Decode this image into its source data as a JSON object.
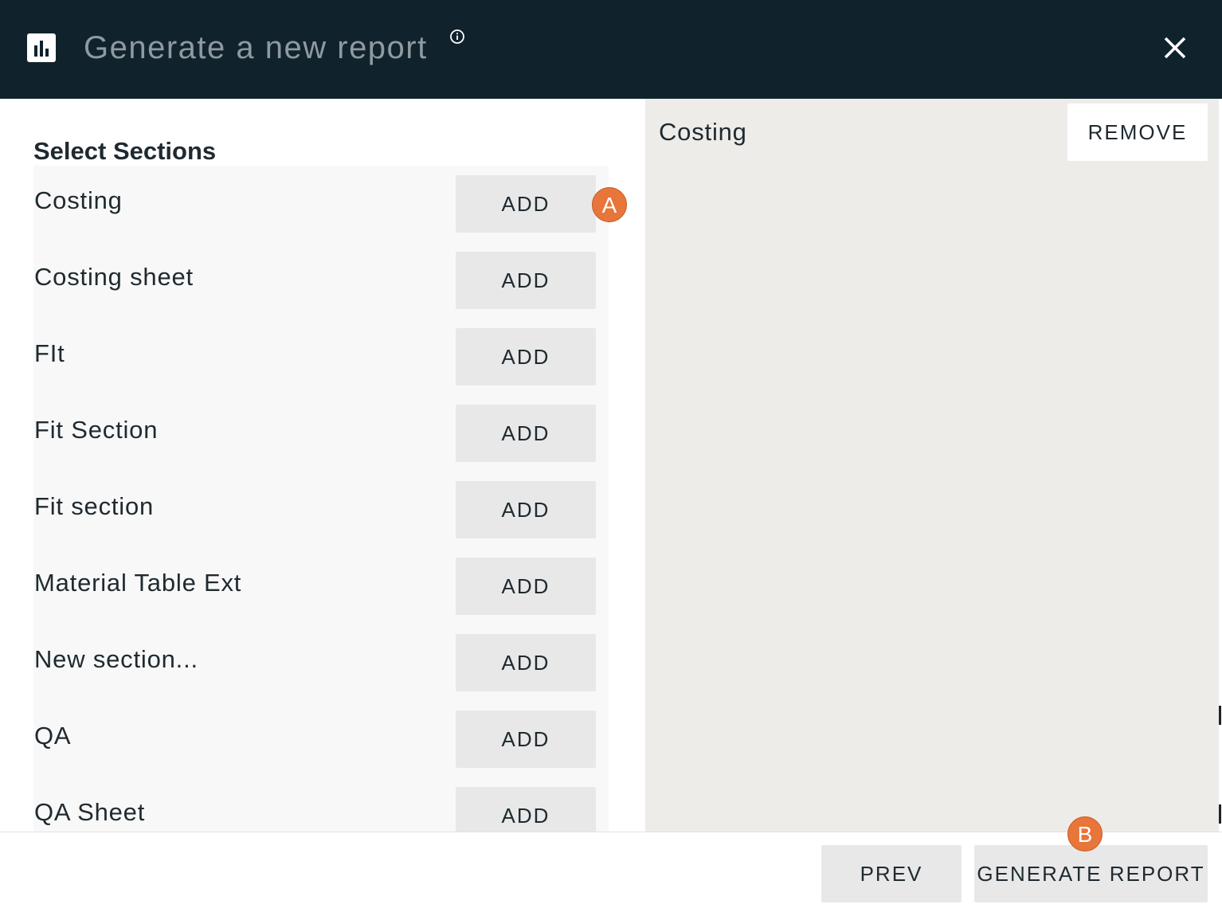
{
  "dialog": {
    "title": "Generate a new report",
    "info_icon": "info-icon",
    "close_icon": "close-icon",
    "logo_icon": "bar-chart-icon"
  },
  "left_panel": {
    "heading": "Select Sections",
    "add_label": "ADD",
    "sections": [
      {
        "label": "Costing"
      },
      {
        "label": "Costing sheet"
      },
      {
        "label": "FIt"
      },
      {
        "label": "Fit Section"
      },
      {
        "label": "Fit section"
      },
      {
        "label": "Material Table Ext"
      },
      {
        "label": "New section..."
      },
      {
        "label": "QA"
      },
      {
        "label": "QA Sheet"
      }
    ]
  },
  "right_panel": {
    "selected": [
      {
        "label": "Costing",
        "remove_label": "REMOVE"
      }
    ]
  },
  "footer": {
    "prev_label": "PREV",
    "generate_label": "GENERATE REPORT"
  },
  "annotations": {
    "marker_a": "A",
    "marker_b": "B",
    "color": "#e8753a"
  },
  "colors": {
    "header_bg": "#10232d",
    "right_panel_bg": "#edece9",
    "button_bg": "#e8e8e8"
  }
}
